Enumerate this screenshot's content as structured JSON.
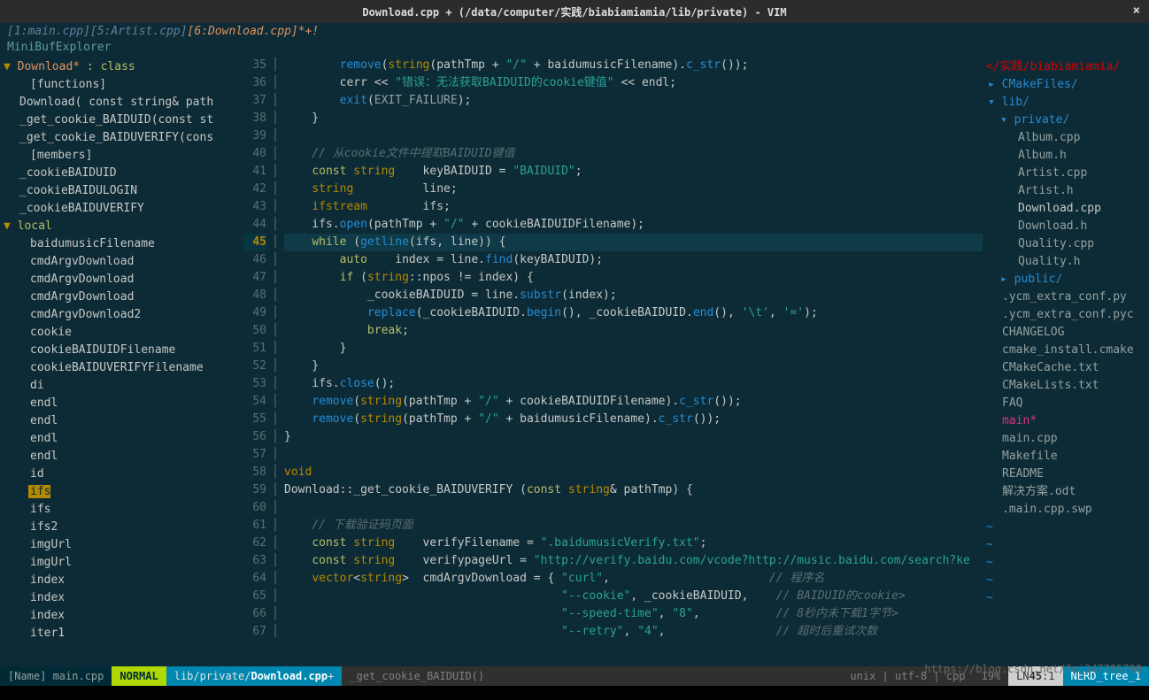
{
  "window": {
    "title": "Download.cpp + (/data/computer/实践/biabiamiamia/lib/private) - VIM",
    "close": "×"
  },
  "tabline": {
    "t1": "[1:main.cpp]",
    "t2": "[5:Artist.cpp]",
    "t3": "[6:Download.cpp]*+!"
  },
  "minibuf": "MiniBufExplorer",
  "tagbar": {
    "class": "Download*",
    "class_kw": " : class",
    "functions": "[functions]",
    "f1": "Download( const string& path",
    "f2": "_get_cookie_BAIDUID(const st",
    "f3": "_get_cookie_BAIDUVERIFY(cons",
    "members": "[members]",
    "m1": "_cookieBAIDUID",
    "m2": "_cookieBAIDULOGIN",
    "m3": "_cookieBAIDUVERIFY",
    "local": "local",
    "vars": [
      "baidumusicFilename",
      "cmdArgvDownload",
      "cmdArgvDownload",
      "cmdArgvDownload",
      "cmdArgvDownload2",
      "cookie",
      "cookieBAIDUIDFilename",
      "cookieBAIDUVERIFYFilename",
      "di",
      "endl",
      "endl",
      "endl",
      "endl",
      "id",
      "ifs",
      "ifs",
      "ifs2",
      "imgUrl",
      "imgUrl",
      "index",
      "index",
      "index",
      "iter1"
    ]
  },
  "code": {
    "lines": [
      {
        "n": 35,
        "html": "        <span class='fn'>remove</span>(<span class='type'>string</span>(pathTmp + <span class='str'>\"/\"</span> + baidumusicFilename).<span class='fn'>c_str</span>());"
      },
      {
        "n": 36,
        "html": "        cerr &lt;&lt; <span class='str'>\"错误：无法获取BAIDUID的cookie键值\"</span> &lt;&lt; endl;"
      },
      {
        "n": 37,
        "html": "        <span class='fn'>exit</span>(<span class='id'>EXIT_FAILURE</span>);"
      },
      {
        "n": 38,
        "html": "    }"
      },
      {
        "n": 39,
        "html": ""
      },
      {
        "n": 40,
        "html": "    <span class='com'>// 从cookie文件中提取BAIDUID键值</span>"
      },
      {
        "n": 41,
        "html": "    <span class='kw'>const</span> <span class='type'>string</span>    keyBAIDUID = <span class='str'>\"BAIDUID\"</span>;"
      },
      {
        "n": 42,
        "html": "    <span class='type'>string</span>          line;"
      },
      {
        "n": 43,
        "html": "    <span class='type'>ifstream</span>        ifs;"
      },
      {
        "n": 44,
        "html": "    ifs.<span class='fn'>open</span>(pathTmp + <span class='str'>\"/\"</span> + cookieBAIDUIDFilename);"
      },
      {
        "n": 45,
        "html": "    <span class='kw'>while</span> (<span class='fn'>getline</span>(ifs, line)) {",
        "current": true
      },
      {
        "n": 46,
        "html": "        <span class='kw'>auto</span>    index = line.<span class='fn'>find</span>(keyBAIDUID);"
      },
      {
        "n": 47,
        "html": "        <span class='kw'>if</span> (<span class='type'>string</span>::npos != index) {"
      },
      {
        "n": 48,
        "html": "            _cookieBAIDUID = line.<span class='fn'>substr</span>(index);"
      },
      {
        "n": 49,
        "html": "            <span class='fn'>replace</span>(_cookieBAIDUID.<span class='fn'>begin</span>(), _cookieBAIDUID.<span class='fn'>end</span>(), <span class='str'>'\\t'</span>, <span class='str'>'='</span>);"
      },
      {
        "n": 50,
        "html": "            <span class='kw'>break</span>;"
      },
      {
        "n": 51,
        "html": "        }"
      },
      {
        "n": 52,
        "html": "    }"
      },
      {
        "n": 53,
        "html": "    ifs.<span class='fn'>close</span>();"
      },
      {
        "n": 54,
        "html": "    <span class='fn'>remove</span>(<span class='type'>string</span>(pathTmp + <span class='str'>\"/\"</span> + cookieBAIDUIDFilename).<span class='fn'>c_str</span>());"
      },
      {
        "n": 55,
        "html": "    <span class='fn'>remove</span>(<span class='type'>string</span>(pathTmp + <span class='str'>\"/\"</span> + baidumusicFilename).<span class='fn'>c_str</span>());"
      },
      {
        "n": 56,
        "html": "}"
      },
      {
        "n": 57,
        "html": ""
      },
      {
        "n": 58,
        "html": "<span class='type'>void</span>"
      },
      {
        "n": 59,
        "html": "Download::_get_cookie_BAIDUVERIFY (<span class='kw'>const</span> <span class='type'>string</span>&amp; pathTmp) {"
      },
      {
        "n": 60,
        "html": ""
      },
      {
        "n": 61,
        "html": "    <span class='com'>// 下载验证码页面</span>"
      },
      {
        "n": 62,
        "html": "    <span class='kw'>const</span> <span class='type'>string</span>    verifyFilename = <span class='str'>\".baidumusicVerify.txt\"</span>;"
      },
      {
        "n": 63,
        "html": "    <span class='kw'>const</span> <span class='type'>string</span>    verifypageUrl = <span class='str'>\"http://verify.baidu.com/vcode?http://music.baidu.com/search?ke</span>"
      },
      {
        "n": 64,
        "html": "    <span class='type'>vector</span>&lt;<span class='type'>string</span>&gt;  cmdArgvDownload = { <span class='str'>\"curl\"</span>,                       <span class='com'>// 程序名</span>"
      },
      {
        "n": 65,
        "html": "                                        <span class='str'>\"--cookie\"</span>, _cookieBAIDUID,    <span class='com'>// BAIDUID的cookie&gt;</span>"
      },
      {
        "n": 66,
        "html": "                                        <span class='str'>\"--speed-time\"</span>, <span class='str'>\"8\"</span>,           <span class='com'>// 8秒内未下载1字节&gt;</span>"
      },
      {
        "n": 67,
        "html": "                                        <span class='str'>\"--retry\"</span>, <span class='str'>\"4\"</span>,                <span class='com'>// 超时后重试次数</span>"
      }
    ]
  },
  "tree": {
    "root": "</实践/biabiamiamia/",
    "d1": "CMakeFiles/",
    "d2": "lib/",
    "d3": "private/",
    "files_private": [
      "Album.cpp",
      "Album.h",
      "Artist.cpp",
      "Artist.h",
      "Download.cpp",
      "Download.h",
      "Quality.cpp",
      "Quality.h"
    ],
    "d4": "public/",
    "files_root": [
      ".ycm_extra_conf.py",
      ".ycm_extra_conf.pyc",
      "CHANGELOG",
      "cmake_install.cmake",
      "CMakeCache.txt",
      "CMakeLists.txt",
      "FAQ",
      "main*",
      "main.cpp",
      "Makefile",
      "README",
      "解决方案.odt",
      ".main.cpp.swp"
    ]
  },
  "status": {
    "name": "[Name] main.cpp",
    "mode": "NORMAL",
    "path_pre": "lib/private/",
    "path_file": "Download.cpp",
    "path_suf": " +",
    "func": "_get_cookie_BAIDUID()",
    "info": "unix | utf-8 | cpp",
    "pct": "19%",
    "ln_label": "LN ",
    "ln": "45",
    "col": ":1",
    "nerd": "NERD_tree_1"
  },
  "watermark": "https://blog.csdn.net/fei347795790"
}
